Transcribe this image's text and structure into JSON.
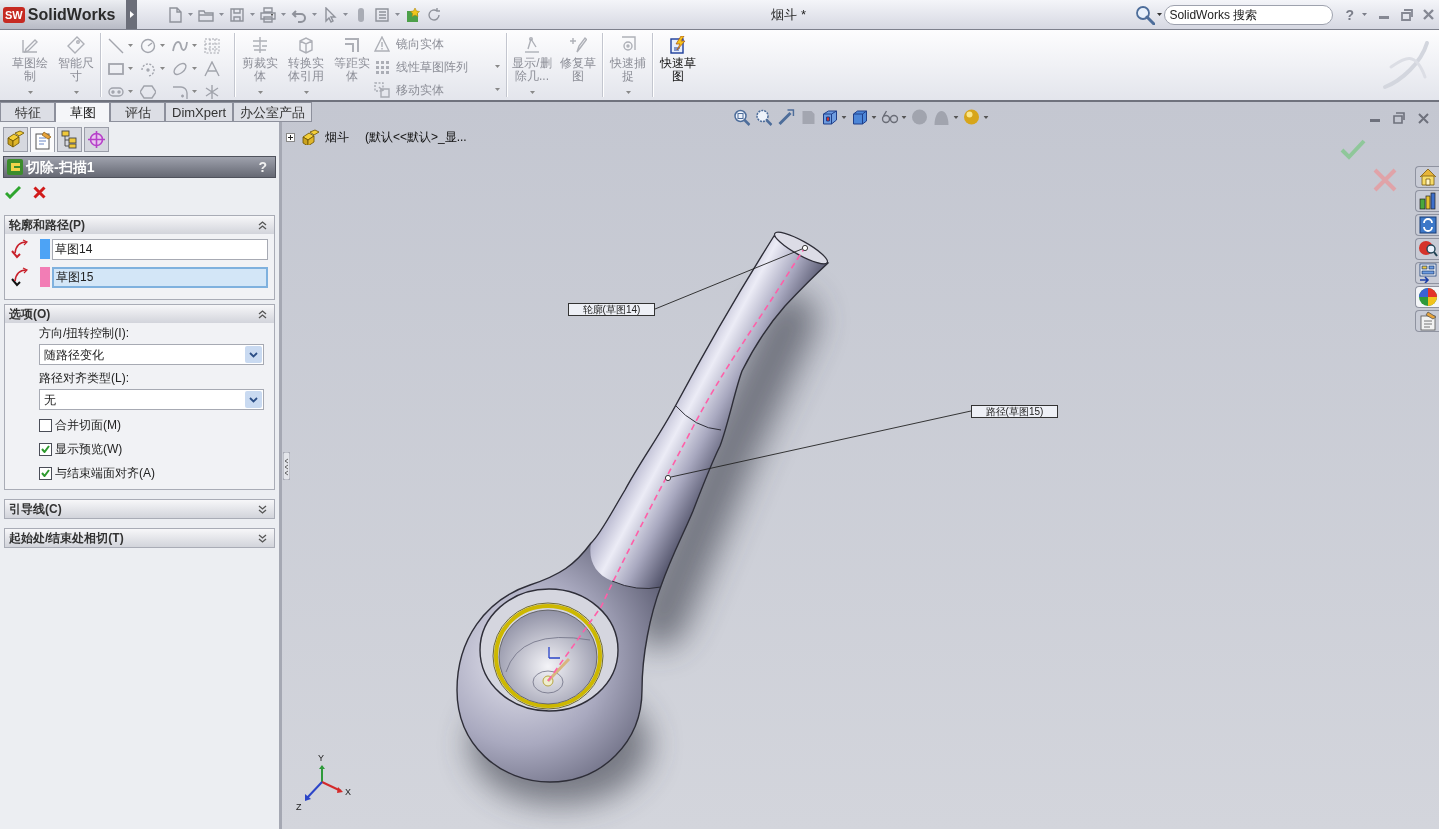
{
  "title_bar": {
    "logo_badge": "SW",
    "app_name": "SolidWorks",
    "document_title": "烟斗 *",
    "search": {
      "placeholder": "SolidWorks 搜索"
    },
    "help": "?"
  },
  "command_manager": {
    "sketch_buttons": [
      {
        "label": "草图绘制",
        "disabled": true,
        "dropdown": true
      },
      {
        "label": "智能尺寸",
        "disabled": true,
        "dropdown": true
      }
    ],
    "modify_buttons": [
      {
        "label": "剪裁实体",
        "disabled": true,
        "dropdown": true
      },
      {
        "label": "转换实体引用",
        "disabled": true,
        "dropdown": true
      },
      {
        "label": "等距实体",
        "disabled": true,
        "dropdown": false
      }
    ],
    "modify_list": [
      {
        "label": "镜向实体",
        "disabled": true,
        "dropdown": false
      },
      {
        "label": "线性草图阵列",
        "disabled": true,
        "dropdown": true
      },
      {
        "label": "移动实体",
        "disabled": true,
        "dropdown": true
      }
    ],
    "tool_buttons": [
      {
        "label": "显示/删除几...",
        "disabled": true,
        "dropdown": true
      },
      {
        "label": "修复草图",
        "disabled": true,
        "dropdown": false
      },
      {
        "label": "快速捕捉",
        "disabled": true,
        "dropdown": true
      },
      {
        "label": "快速草图",
        "disabled": false,
        "dropdown": false
      }
    ]
  },
  "command_tabs": [
    {
      "label": "特征",
      "selected": false
    },
    {
      "label": "草图",
      "selected": true
    },
    {
      "label": "评估",
      "selected": false
    },
    {
      "label": "DimXpert",
      "selected": false
    },
    {
      "label": "办公室产品",
      "selected": false
    }
  ],
  "manager_tabs": [
    {
      "selected": false
    },
    {
      "selected": true
    },
    {
      "selected": false
    },
    {
      "selected": false
    }
  ],
  "property_manager": {
    "title": "切除-扫描1",
    "help": "?",
    "sections": [
      {
        "kind": "selections",
        "title": "轮廓和路径(P)",
        "expanded": true,
        "items": [
          {
            "value": "草图14",
            "color": "#4da3f5",
            "selected": false
          },
          {
            "value": "草图15",
            "color": "#f27db5",
            "selected": true
          }
        ]
      },
      {
        "kind": "options",
        "title": "选项(O)",
        "expanded": true,
        "dropdowns": [
          {
            "label": "方向/扭转控制(I):",
            "value": "随路径变化"
          },
          {
            "label": "路径对齐类型(L):",
            "value": "无"
          }
        ],
        "checkboxes": [
          {
            "label": "合并切面(M)",
            "checked": false
          },
          {
            "label": "显示预览(W)",
            "checked": true
          },
          {
            "label": "与结束端面对齐(A)",
            "checked": true
          }
        ]
      },
      {
        "title": "引导线(C)",
        "expanded": false
      },
      {
        "title": "起始处/结束处相切(T)",
        "expanded": false
      }
    ]
  },
  "viewport": {
    "feature_tree": {
      "expanded": false,
      "name": "烟斗",
      "configuration": "(默认<<默认>_显..."
    },
    "callouts": [
      {
        "text": "轮廓(草图14)"
      },
      {
        "text": "路径(草图15)"
      }
    ],
    "triad": {
      "x": "X",
      "y": "Y",
      "z": "Z"
    },
    "task_pane": [
      {
        "selected": false
      },
      {
        "selected": false
      },
      {
        "selected": false
      },
      {
        "selected": false
      },
      {
        "selected": false
      },
      {
        "selected": true
      },
      {
        "selected": false
      }
    ]
  }
}
